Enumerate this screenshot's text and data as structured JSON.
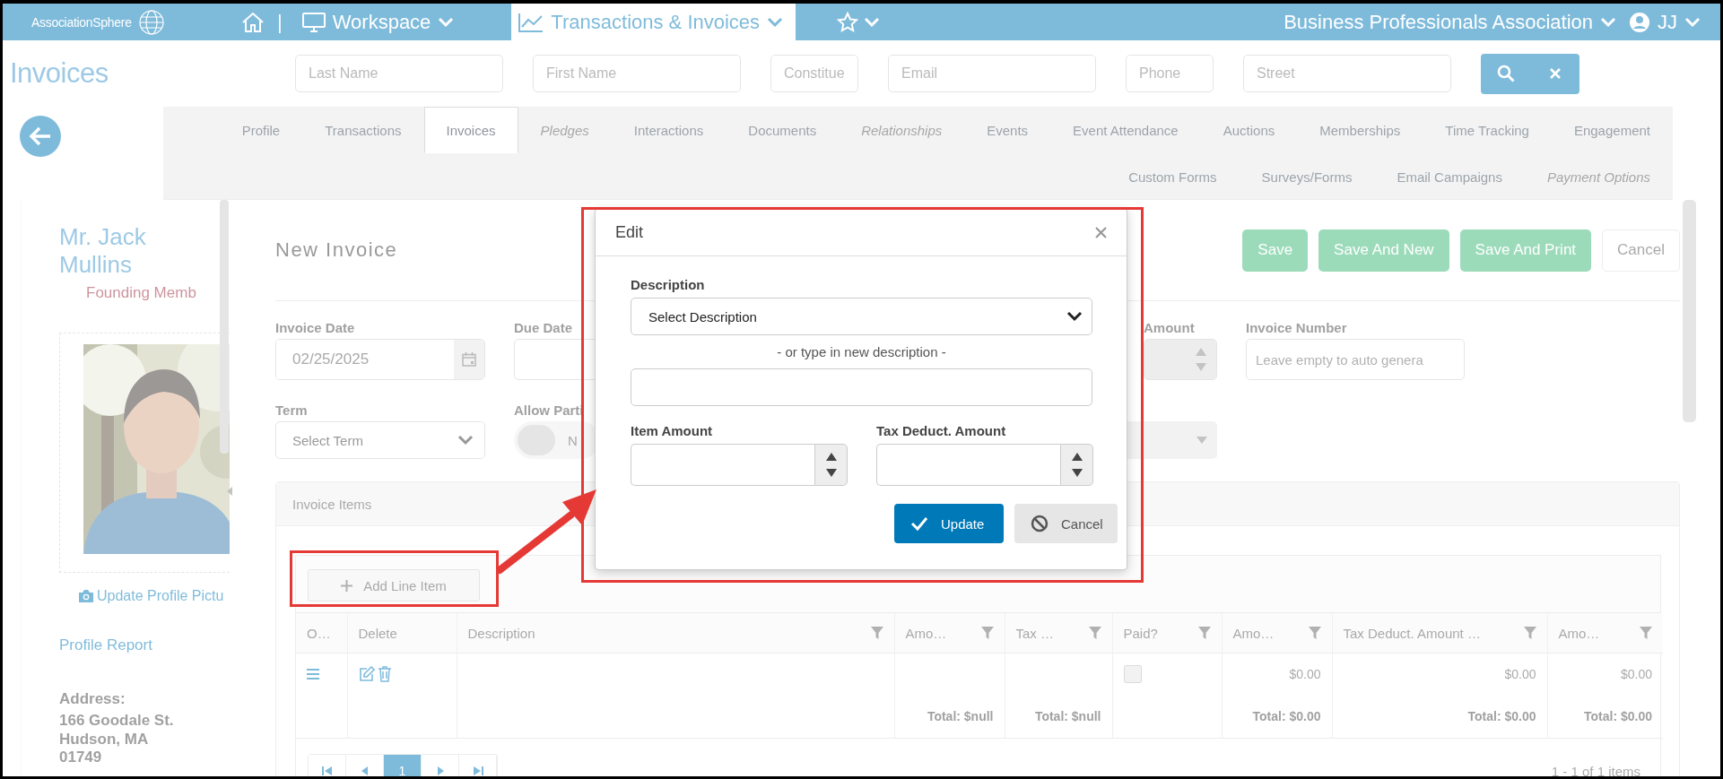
{
  "nav": {
    "logo": "AssociationSphere",
    "separator": "|",
    "menus": [
      {
        "label": "Workspace",
        "kind": "monitor",
        "selected": false
      },
      {
        "label": "Transactions & Invoices",
        "kind": "chart",
        "selected": true
      }
    ],
    "organization": "Business Professionals Association",
    "user": "JJ"
  },
  "page_title": "Invoices",
  "search": {
    "fields": [
      {
        "placeholder": "Last Name"
      },
      {
        "placeholder": "First Name"
      },
      {
        "placeholder": "Constitue"
      },
      {
        "placeholder": "Email"
      },
      {
        "placeholder": "Phone"
      },
      {
        "placeholder": "Street"
      }
    ]
  },
  "tabs": [
    {
      "label": "Profile",
      "selected": false,
      "disabled": false
    },
    {
      "label": "Transactions",
      "selected": false,
      "disabled": false
    },
    {
      "label": "Invoices",
      "selected": true,
      "disabled": false
    },
    {
      "label": "Pledges",
      "selected": false,
      "disabled": true
    },
    {
      "label": "Interactions",
      "selected": false,
      "disabled": false
    },
    {
      "label": "Documents",
      "selected": false,
      "disabled": false
    },
    {
      "label": "Relationships",
      "selected": false,
      "disabled": true
    },
    {
      "label": "Events",
      "selected": false,
      "disabled": false
    },
    {
      "label": "Event Attendance",
      "selected": false,
      "disabled": false
    },
    {
      "label": "Auctions",
      "selected": false,
      "disabled": false
    },
    {
      "label": "Memberships",
      "selected": false,
      "disabled": false
    },
    {
      "label": "Time Tracking",
      "selected": false,
      "disabled": false
    },
    {
      "label": "Engagement",
      "selected": false,
      "disabled": false
    },
    {
      "label": "Custom Forms",
      "selected": false,
      "disabled": false
    },
    {
      "label": "Surveys/Forms",
      "selected": false,
      "disabled": false
    },
    {
      "label": "Email Campaigns",
      "selected": false,
      "disabled": false
    },
    {
      "label": "Payment Options",
      "selected": false,
      "disabled": true
    }
  ],
  "profile": {
    "name": "Mr. Jack Mullins",
    "membership": "Founding Memb",
    "photo": {
      "kind": "picture"
    },
    "update_photo": "Update Profile Pictu",
    "report_link": "Profile Report",
    "address_label": "Address:",
    "address_lines": [
      "166 Goodale St.",
      "Hudson, MA",
      "01749"
    ]
  },
  "form": {
    "title": "New Invoice",
    "actions": [
      {
        "label": "Save",
        "kind": "primary"
      },
      {
        "label": "Save And New",
        "kind": "primary"
      },
      {
        "label": "Save And Print",
        "kind": "primary"
      },
      {
        "label": "Cancel",
        "kind": "secondary"
      }
    ],
    "invoice_date": {
      "label": "Invoice Date",
      "value": "02/25/2025"
    },
    "due_date": {
      "label": "Due Date"
    },
    "amount": {
      "label": "Amount"
    },
    "invoice_number": {
      "label": "Invoice Number",
      "placeholder": "Leave empty to auto genera"
    },
    "term": {
      "label": "Term",
      "value": "Select Term"
    },
    "allow_partial": {
      "label": "Allow Parti",
      "on": false,
      "state_text": "N"
    }
  },
  "invoice_items": {
    "title": "Invoice Items",
    "add_button": "Add Line Item",
    "columns": [
      {
        "header": "O…",
        "filter": false
      },
      {
        "header": "Delete",
        "filter": false
      },
      {
        "header": "Description",
        "filter": true
      },
      {
        "header": "Amo…",
        "filter": true
      },
      {
        "header": "Tax …",
        "filter": true
      },
      {
        "header": "Paid?",
        "filter": true
      },
      {
        "header": "Amo…",
        "filter": true
      },
      {
        "header": "Tax Deduct. Amount …",
        "filter": true
      },
      {
        "header": "Amo…",
        "filter": true
      }
    ],
    "rows": [
      {
        "cells": [
          {
            "kind": "order"
          },
          {
            "kind": "actions"
          },
          {
            "kind": "blank"
          },
          {
            "kind": "blank"
          },
          {
            "kind": "blank"
          },
          {
            "kind": "check",
            "checked": false
          },
          {
            "kind": "money",
            "text": "$0.00"
          },
          {
            "kind": "money",
            "text": "$0.00"
          },
          {
            "kind": "money",
            "text": "$0.00"
          }
        ]
      }
    ],
    "footer": [
      {
        "kind": "blank"
      },
      {
        "kind": "blank"
      },
      {
        "kind": "blank"
      },
      {
        "kind": "total",
        "text": "Total: $null"
      },
      {
        "kind": "total",
        "text": "Total: $null"
      },
      {
        "kind": "blank"
      },
      {
        "kind": "total",
        "text": "Total: $0.00"
      },
      {
        "kind": "total",
        "text": "Total: $0.00"
      },
      {
        "kind": "total",
        "text": "Total: $0.00"
      }
    ],
    "pages": [
      {
        "label": "1",
        "selected": true
      }
    ],
    "pager_info": "1 - 1 of 1 items"
  },
  "modal": {
    "title": "Edit",
    "description_label": "Description",
    "description_select": "Select Description",
    "hint": "- or type in new description -",
    "item_amount_label": "Item Amount",
    "tax_amount_label": "Tax Deduct. Amount",
    "buttons": [
      {
        "label": "Update",
        "kind": "primary"
      },
      {
        "label": "Cancel",
        "kind": "secondary"
      }
    ]
  }
}
